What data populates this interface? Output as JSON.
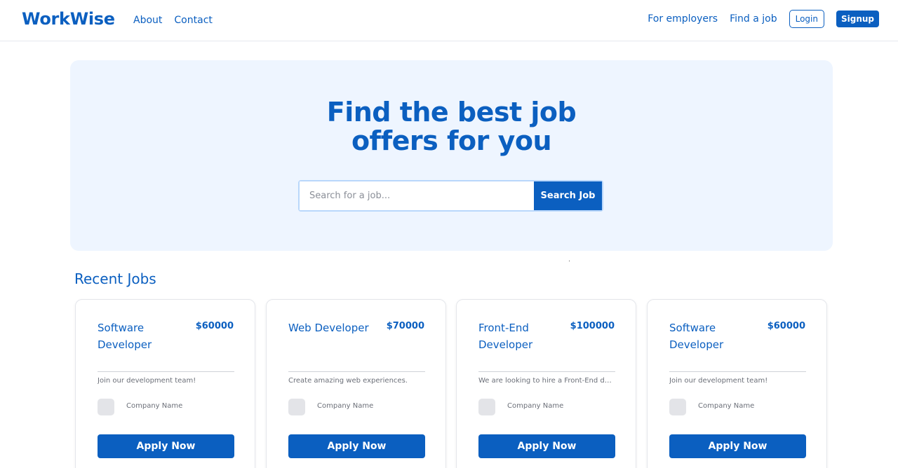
{
  "brand": {
    "name": "WorkWise"
  },
  "nav": {
    "left": [
      {
        "label": "About"
      },
      {
        "label": "Contact"
      }
    ],
    "right": [
      {
        "label": "For employers"
      },
      {
        "label": "Find a job"
      }
    ],
    "login_label": "Login",
    "signup_label": "Signup"
  },
  "hero": {
    "title_line1": "Find the best job",
    "title_line2": "offers for you",
    "search_placeholder": "Search for a job...",
    "search_value": "",
    "search_button": "Search Job"
  },
  "recent": {
    "title": "Recent Jobs",
    "jobs": [
      {
        "title": "Software Developer",
        "salary": "$60000",
        "description": "Join our development team!",
        "company": "Company Name",
        "apply_label": "Apply Now"
      },
      {
        "title": "Web Developer",
        "salary": "$70000",
        "description": "Create amazing web experiences.",
        "company": "Company Name",
        "apply_label": "Apply Now"
      },
      {
        "title": "Front-End Developer",
        "salary": "$100000",
        "description": "We are looking to hire a Front-End developer",
        "company": "Company Name",
        "apply_label": "Apply Now"
      },
      {
        "title": "Software Developer",
        "salary": "$60000",
        "description": "Join our development team!",
        "company": "Company Name",
        "apply_label": "Apply Now"
      }
    ]
  },
  "colors": {
    "primary": "#0b5fc0",
    "hero_bg": "#eef5ff",
    "muted": "#6b6f78"
  }
}
